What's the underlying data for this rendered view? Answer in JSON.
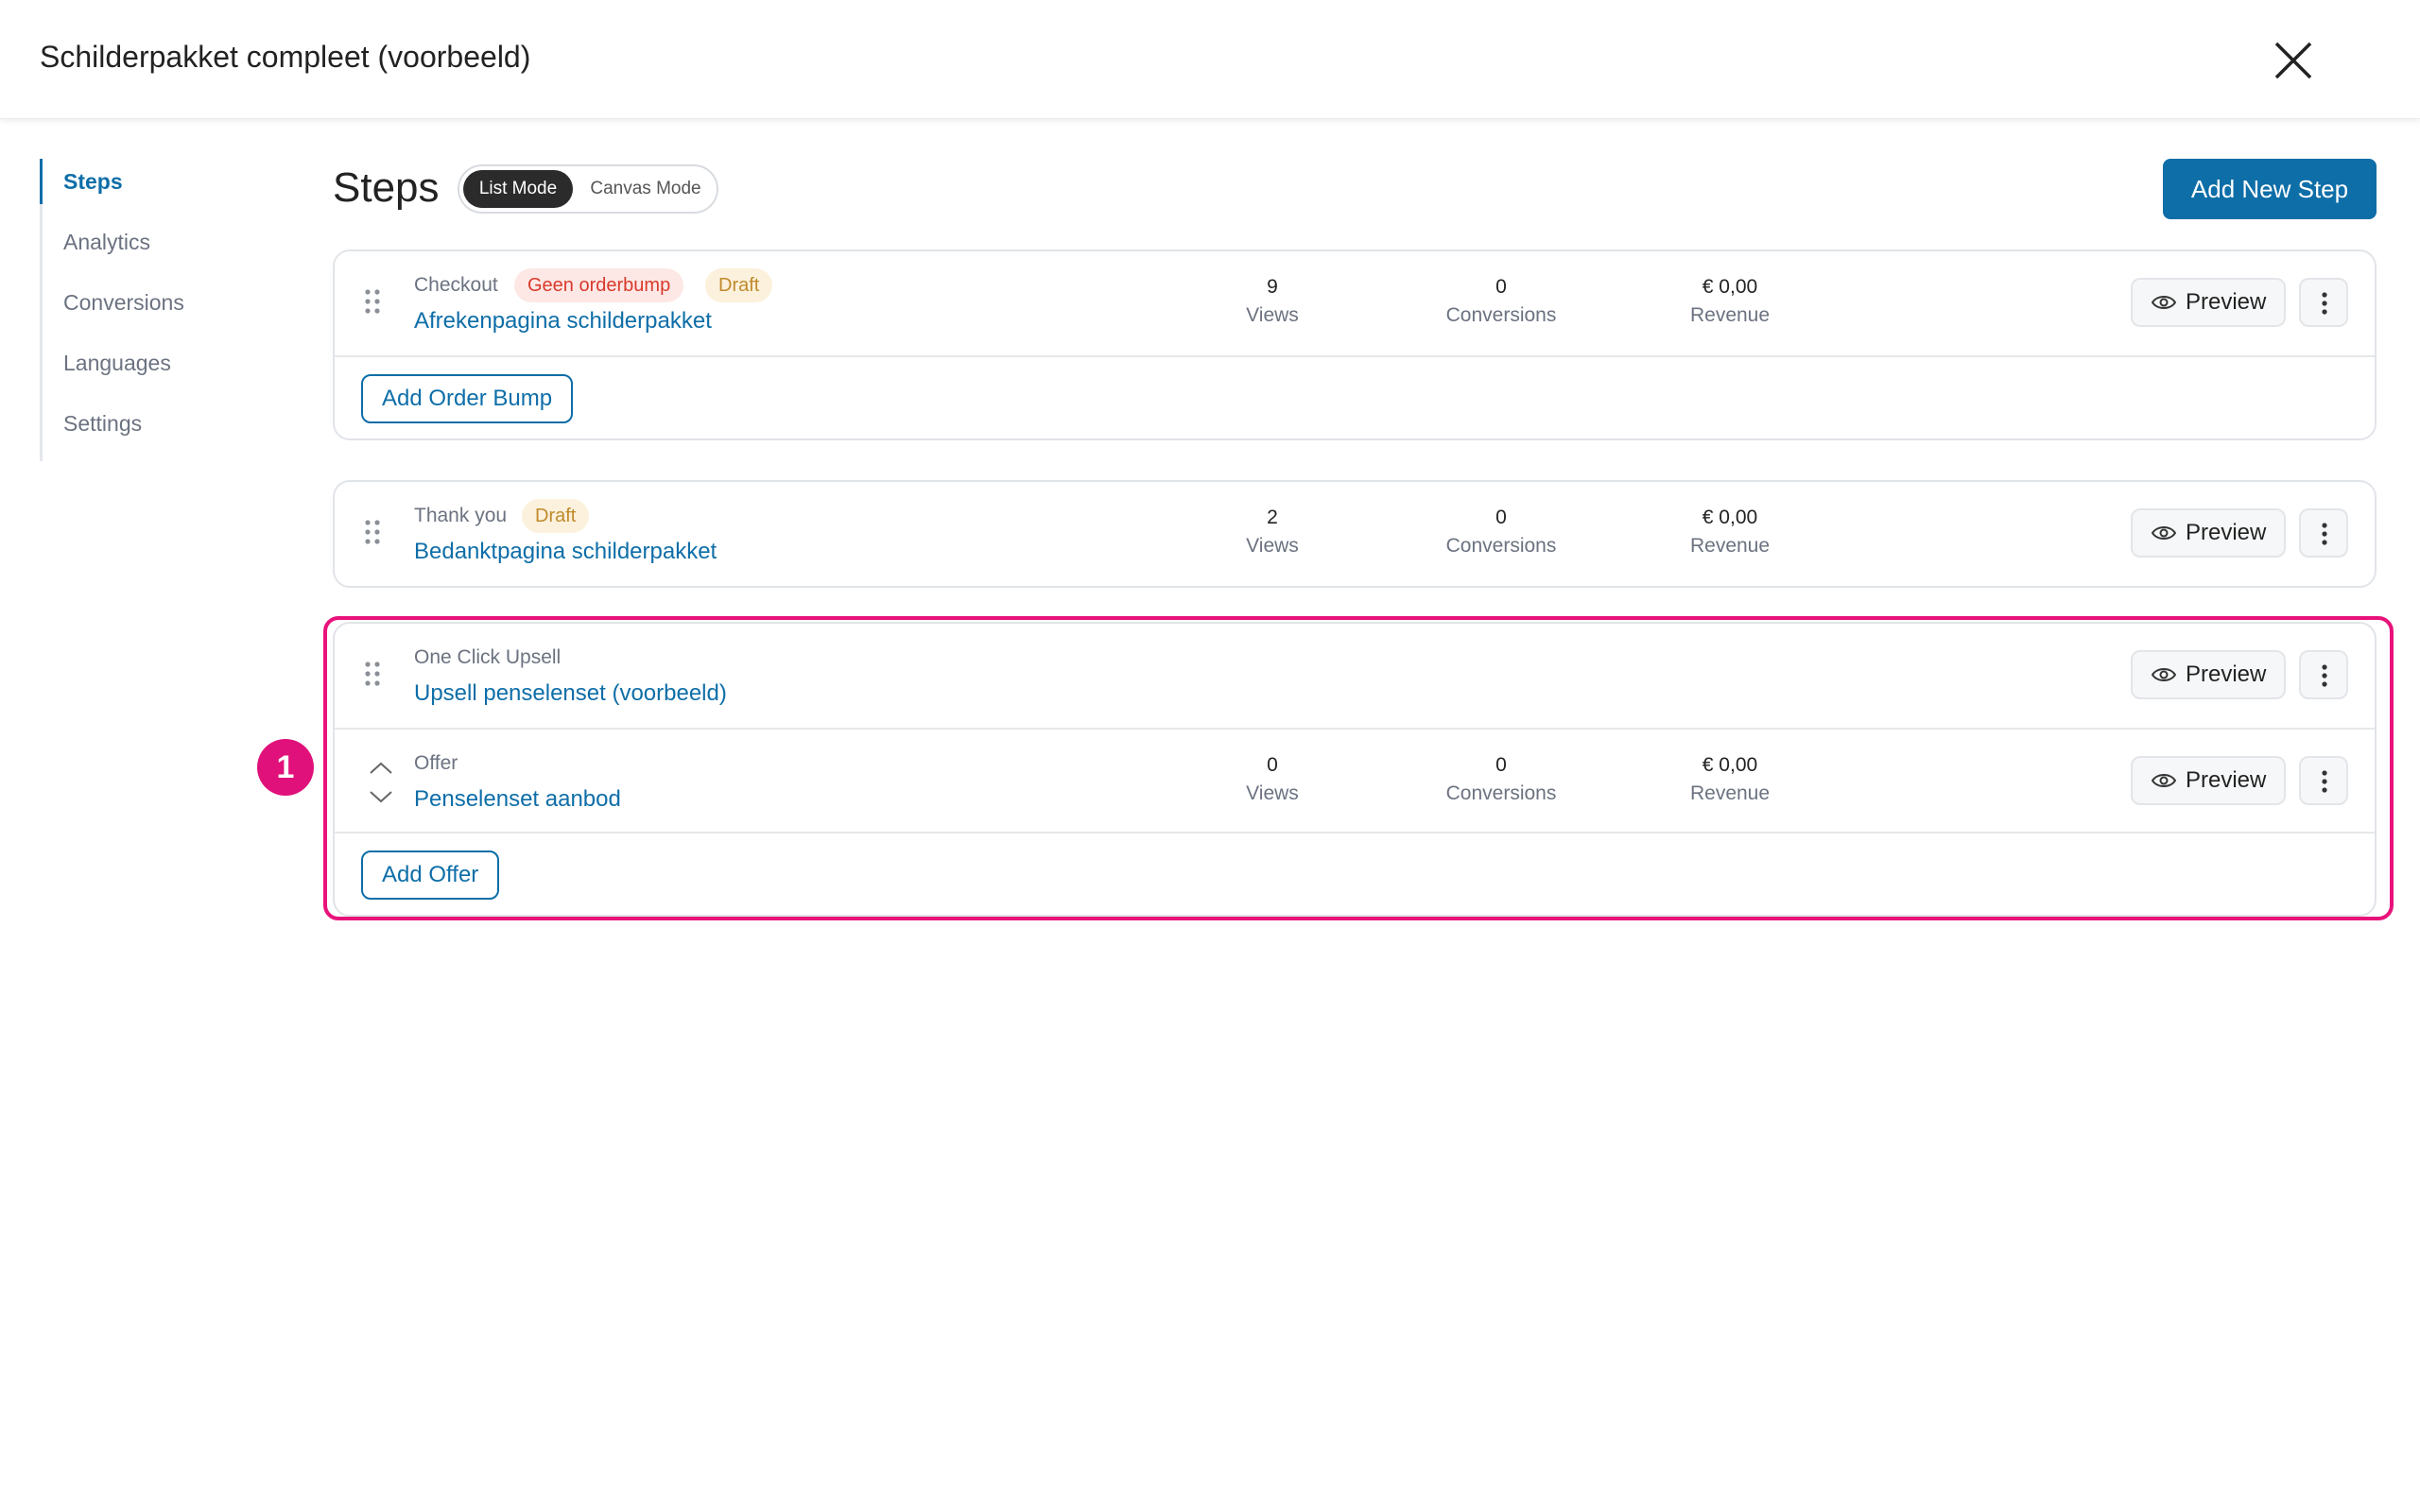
{
  "header": {
    "title": "Schilderpakket compleet (voorbeeld)",
    "close_icon": "close-icon"
  },
  "sidebar": {
    "items": [
      {
        "label": "Steps",
        "active": true
      },
      {
        "label": "Analytics"
      },
      {
        "label": "Conversions"
      },
      {
        "label": "Languages"
      },
      {
        "label": "Settings"
      }
    ]
  },
  "main": {
    "title": "Steps",
    "modes": {
      "list": "List Mode",
      "canvas": "Canvas Mode"
    },
    "add_step_label": "Add New Step",
    "preview_label": "Preview",
    "metric_labels": {
      "views": "Views",
      "conversions": "Conversions",
      "revenue": "Revenue"
    },
    "steps": [
      {
        "type": "Checkout",
        "badges": [
          "Geen orderbump",
          "Draft"
        ],
        "name": "Afrekenpagina schilderpakket",
        "views": "9",
        "conversions": "0",
        "revenue": "€ 0,00",
        "footer_button": "Add Order Bump"
      },
      {
        "type": "Thank you",
        "badges": [
          "Draft"
        ],
        "name": "Bedanktpagina schilderpakket",
        "views": "2",
        "conversions": "0",
        "revenue": "€ 0,00"
      },
      {
        "type": "One Click Upsell",
        "name": "Upsell penselenset (voorbeeld)",
        "offer": {
          "type": "Offer",
          "name": "Penselenset aanbod",
          "views": "0",
          "conversions": "0",
          "revenue": "€ 0,00"
        },
        "footer_button": "Add Offer"
      }
    ]
  },
  "annotation": {
    "marker": "1",
    "color": "#e8127a"
  },
  "colors": {
    "accent": "#0e6ea8",
    "draft": "#c08a2b",
    "warning": "#d93a2b"
  }
}
